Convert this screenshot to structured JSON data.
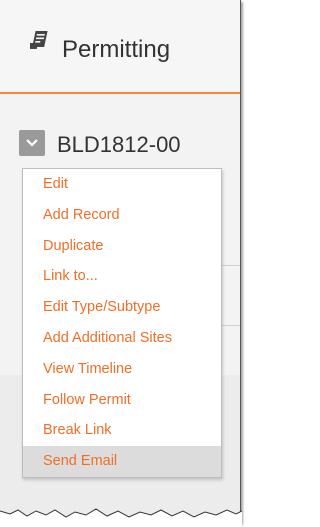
{
  "header": {
    "title": "Permitting",
    "icon": "permit-document-icon"
  },
  "record": {
    "id": "BLD1812-00",
    "menu_toggle_icon": "chevron-down-icon"
  },
  "menu": {
    "items": [
      {
        "label": "Edit"
      },
      {
        "label": "Add Record"
      },
      {
        "label": "Duplicate"
      },
      {
        "label": "Link to..."
      },
      {
        "label": "Edit Type/Subtype"
      },
      {
        "label": "Add Additional Sites"
      },
      {
        "label": "View Timeline"
      },
      {
        "label": "Follow Permit"
      },
      {
        "label": "Break Link"
      },
      {
        "label": "Send Email"
      }
    ],
    "highlighted_item": "Send Email"
  },
  "colors": {
    "accent": "#ef6f27",
    "rule": "#f0893c",
    "toggle_bg": "#9a9a9a",
    "highlight_bg": "#dcdcdc"
  }
}
